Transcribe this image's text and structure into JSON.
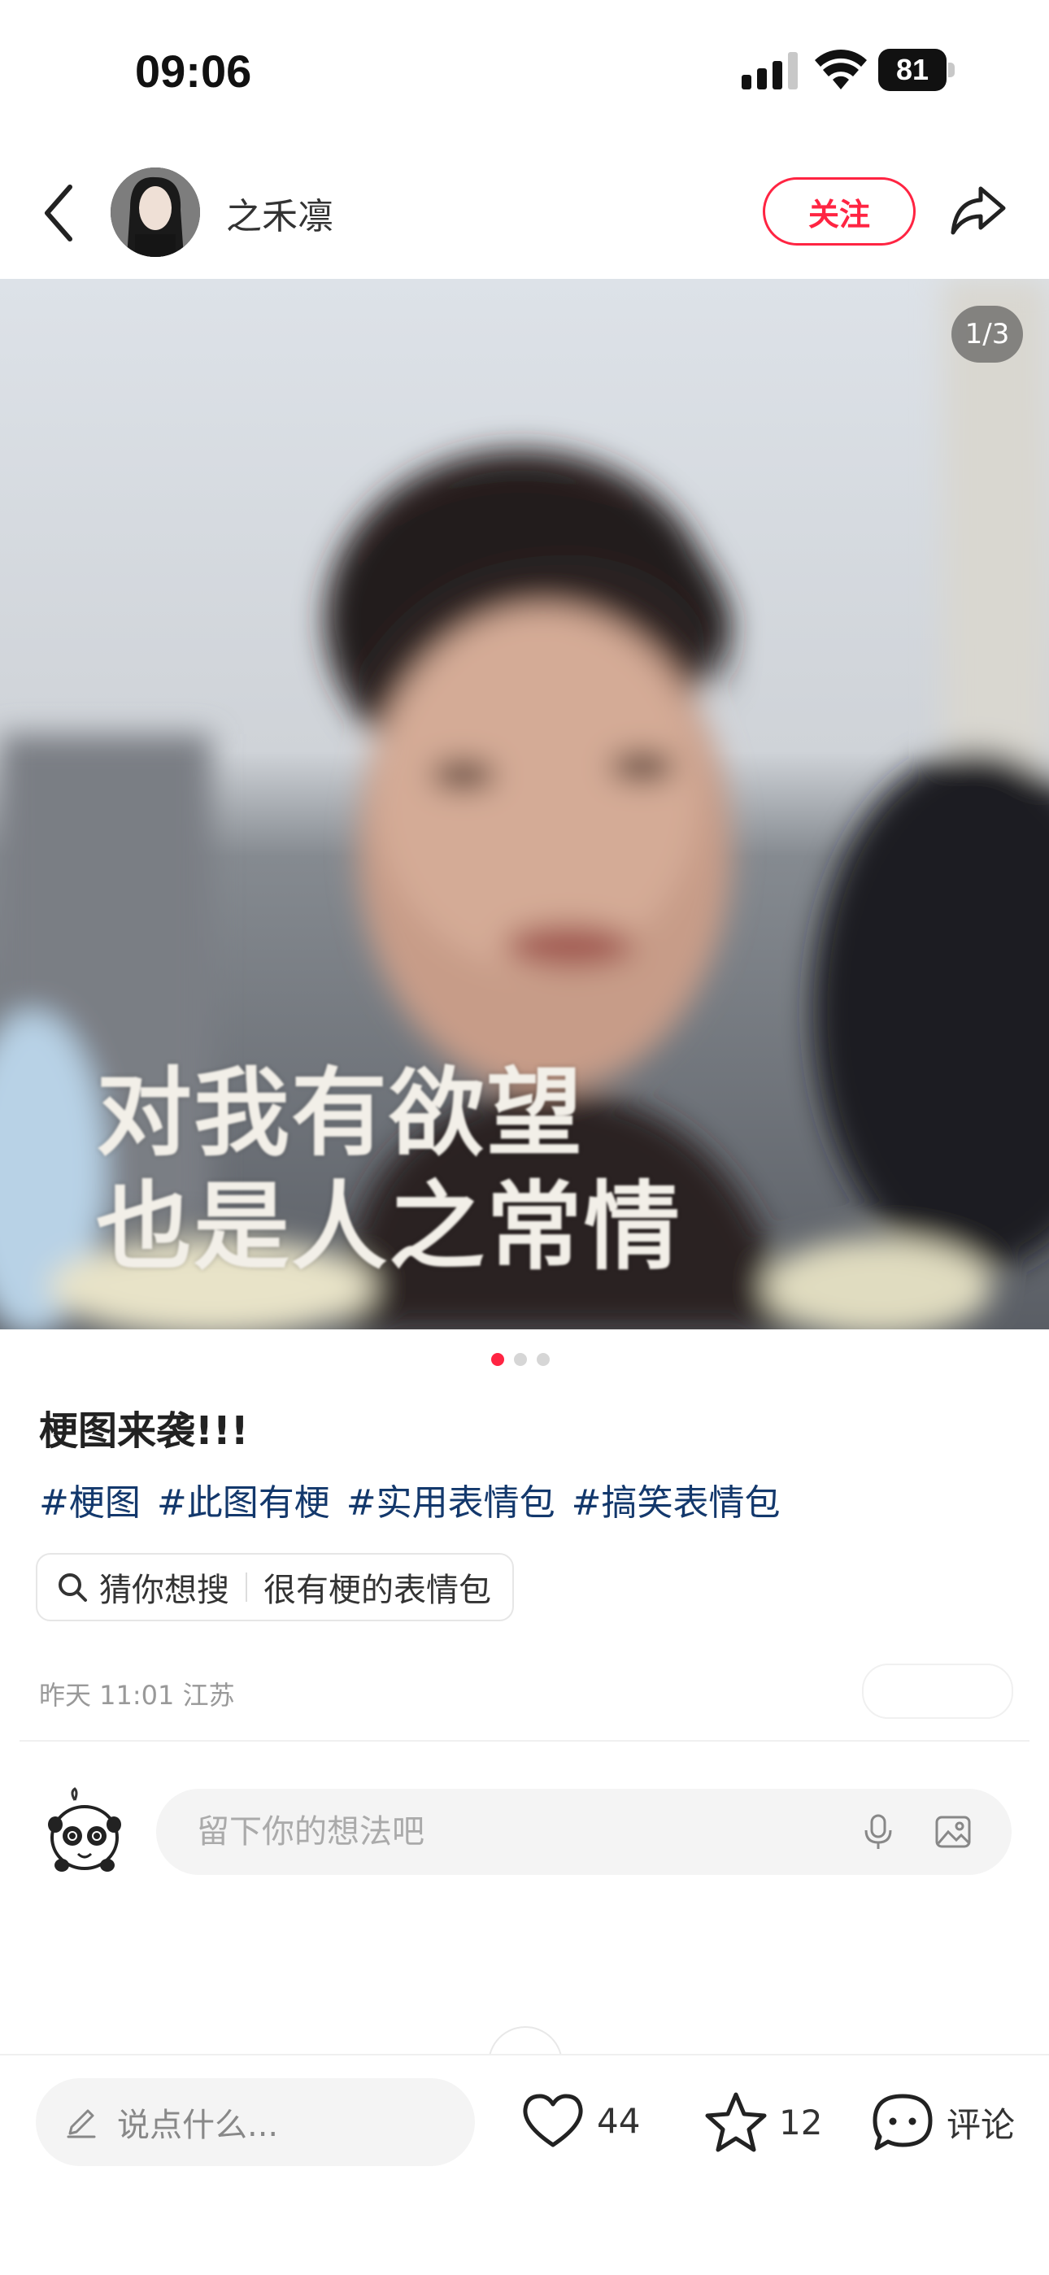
{
  "status_bar": {
    "time": "09:06",
    "battery": "81"
  },
  "header": {
    "author": "之禾凛",
    "follow_label": "关注"
  },
  "media": {
    "counter": "1/3",
    "caption_line1": "对我有欲望",
    "caption_line2": "也是人之常情",
    "active_dot": 1,
    "dots": 3
  },
  "post": {
    "title": "梗图来袭!!!",
    "tags": [
      "#梗图",
      "#此图有梗",
      "#实用表情包",
      "#搞笑表情包"
    ],
    "suggest_label": "猜你想搜",
    "suggest_query": "很有梗的表情包",
    "meta": "昨天 11:01 江苏"
  },
  "comment": {
    "placeholder": "留下你的想法吧"
  },
  "bottom_bar": {
    "say_placeholder": "说点什么...",
    "likes": "44",
    "favorites": "12",
    "comment_label": "评论"
  },
  "colors": {
    "accent": "#ff2442",
    "tag": "#13386c"
  },
  "icons": [
    "back-icon",
    "share-icon",
    "search-icon",
    "mic-icon",
    "image-icon",
    "pen-icon",
    "heart-icon",
    "star-icon",
    "comment-icon"
  ]
}
